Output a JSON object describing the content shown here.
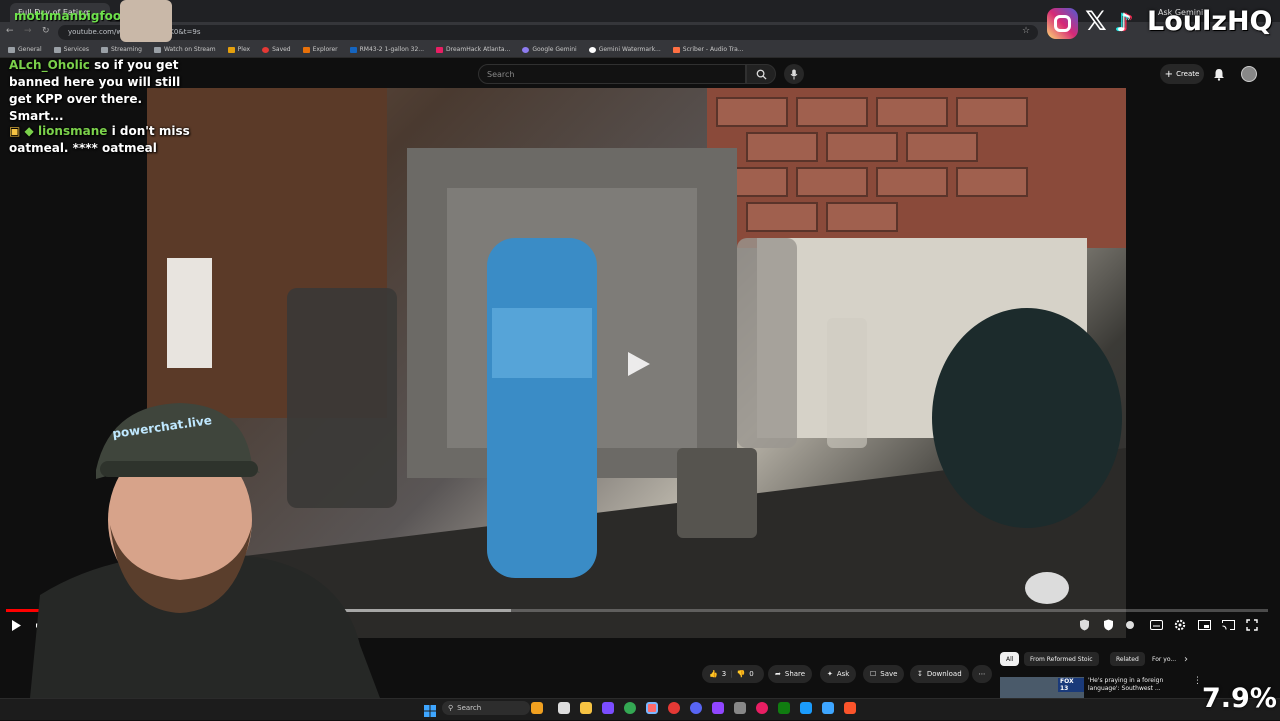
{
  "browser": {
    "tab_title": "Full Day of Eating",
    "gemini_tab": "Ask Gemini",
    "url": "youtube.com/watch?v=...ofVK0&t=9s",
    "bookmarks": [
      "General",
      "Services",
      "Streaming",
      "Watch on Stream",
      "Plex",
      "Saved",
      "Explorer",
      "RM43-2 1-gallon 32...",
      "DreamHack Atlanta...",
      "Google Gemini",
      "Gemini Watermark...",
      "Scriber - Audio Tra..."
    ]
  },
  "youtube": {
    "search_placeholder": "Search",
    "create_label": "Create",
    "video": {
      "progress_played_fraction": 0.05,
      "progress_buffered_fraction": 0.4
    },
    "actions": {
      "likes": "3",
      "dislikes": "0",
      "share": "Share",
      "ask": "Ask",
      "save": "Save",
      "download": "Download"
    },
    "chips": [
      "All",
      "From Reformed Stoic",
      "Related",
      "For yo..."
    ],
    "recommendation": {
      "title": "'He's praying in a foreign language': Southwest ...",
      "channel_badge": "FOX 13"
    }
  },
  "stream_overlay": {
    "streamer_name": "mothmanbigfoot",
    "chat": [
      {
        "user": "ALch_Oholic",
        "message": "so if you get banned here you will still get KPP over there. Smart..."
      },
      {
        "user": "lionsmane",
        "message": "i don't miss oatmeal. **** oatmeal"
      }
    ],
    "brand": "LoulzHQ",
    "cap_text": "powerchat.live",
    "percent": "7.9%"
  },
  "taskbar": {
    "search_label": "Search"
  },
  "colors": {
    "accent_red": "#ff0000",
    "chat_name_green": "#7bd14b",
    "youtube_bg": "#0f0f0f"
  }
}
